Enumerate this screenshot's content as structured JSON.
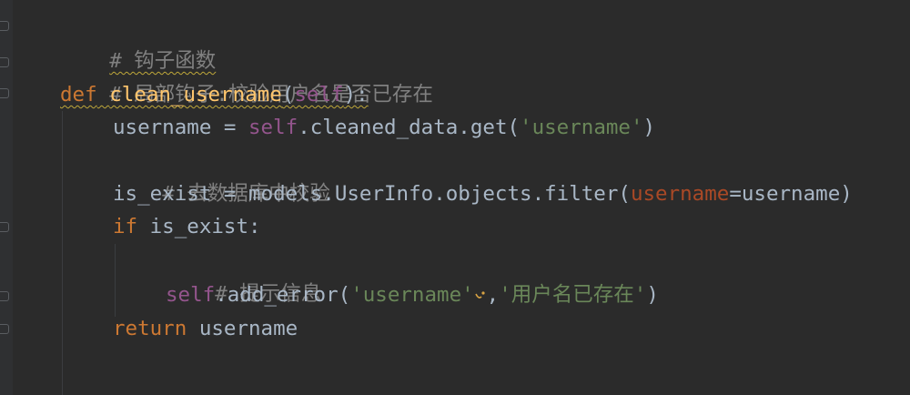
{
  "editor": {
    "language": "python",
    "lines": [
      {
        "comment": "# 钩子函数"
      },
      {
        "comment": "# 局部钩子:校验用户名是否已存在"
      },
      {
        "kw_def": "def",
        "func_name": "clean_username",
        "open": "(",
        "self": "self",
        "close": "):"
      },
      {
        "var": "username = ",
        "self": "self",
        "rest": ".cleaned_data.get(",
        "str": "'username'",
        "end": ")"
      },
      {
        "comment": "# 去数据库中校验"
      },
      {
        "var": "is_exist = models.UserInfo.objects.filter(",
        "param": "username",
        "rest": "=username)"
      },
      {
        "kw_if": "if",
        "rest": " is_exist:"
      },
      {
        "comment": "# 提示信息"
      },
      {
        "self": "self",
        "rest": ".add_error(",
        "str1": "'username'",
        "comma": ",",
        "str2": "'用户名已存在'",
        "end": ")"
      },
      {
        "kw_return": "return",
        "rest": " username"
      }
    ]
  },
  "colors": {
    "background": "#2b2b2b",
    "text": "#a9b7c6",
    "comment": "#808080",
    "keyword": "#cc7832",
    "self": "#94558d",
    "function": "#ffc66d",
    "string": "#6a8759",
    "param": "#aa4926"
  },
  "icons": [
    "fold-marker-icon",
    "intention-bulb-icon"
  ]
}
